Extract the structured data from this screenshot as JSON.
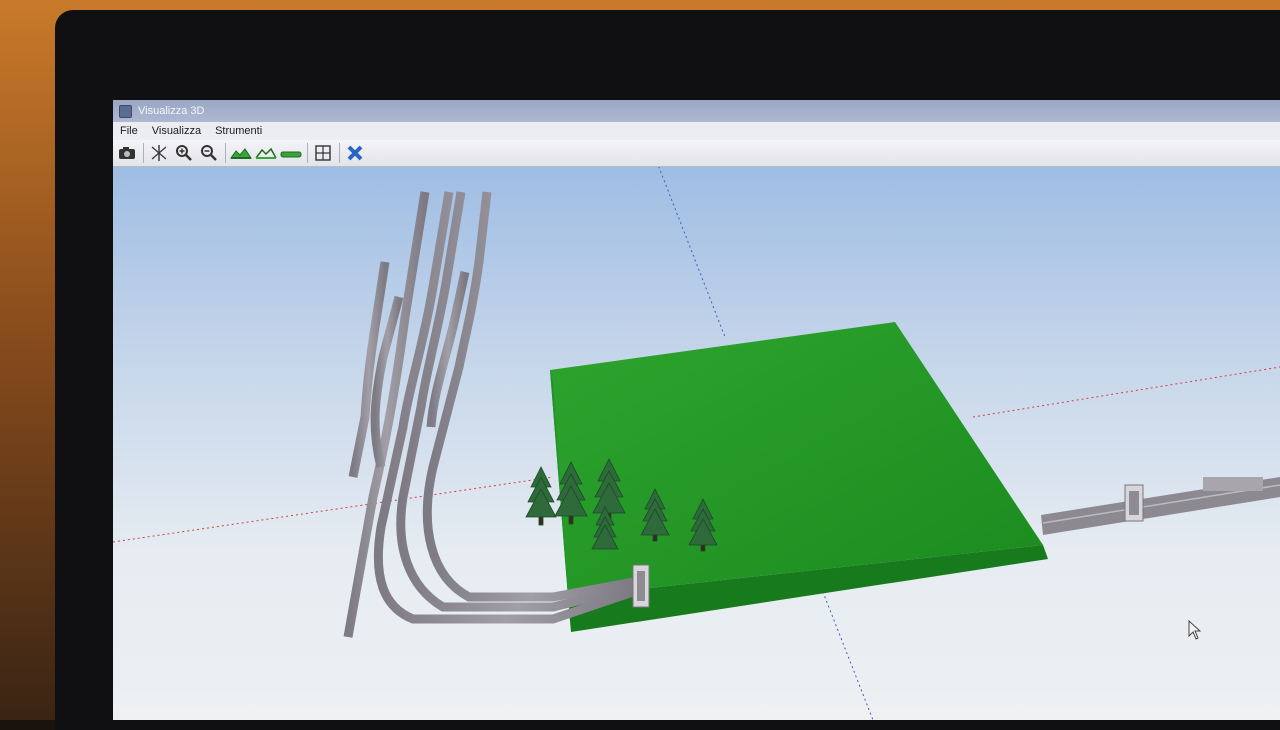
{
  "window": {
    "title": "Visualizza 3D"
  },
  "menu": {
    "file": "File",
    "view": "Visualizza",
    "tools": "Strumenti"
  },
  "toolbar": {
    "icons": [
      "camera-icon",
      "axes-icon",
      "zoom-in-icon",
      "zoom-out-icon",
      "terrain-icon",
      "terrain-wire-icon",
      "flat-terrain-icon",
      "grid-icon",
      "close-icon"
    ]
  },
  "scene": {
    "colors": {
      "terrain": "#2fae2f",
      "terrain_dark": "#1f8a24",
      "track": "#8a8690",
      "tree": "#2e6a3a",
      "axis_x": "#d04040",
      "axis_y": "#3a5ec8"
    }
  }
}
